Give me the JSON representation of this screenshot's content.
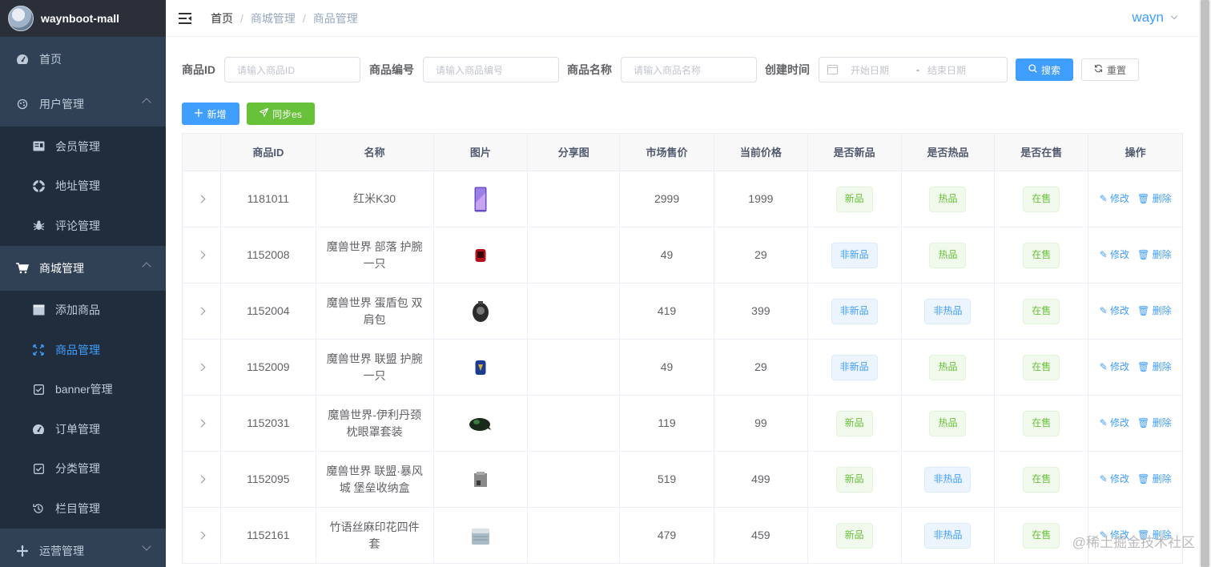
{
  "app": {
    "title": "waynboot-mall"
  },
  "sidebar": {
    "items": [
      {
        "label": "首页",
        "icon": "dashboard-icon"
      },
      {
        "label": "用户管理",
        "icon": "user-icon",
        "expanded": true,
        "children": [
          {
            "label": "会员管理",
            "icon": "member-icon"
          },
          {
            "label": "地址管理",
            "icon": "address-icon"
          },
          {
            "label": "评论管理",
            "icon": "bug-icon"
          }
        ]
      },
      {
        "label": "商城管理",
        "icon": "cart-icon",
        "expanded": true,
        "children": [
          {
            "label": "添加商品",
            "icon": "folder-icon"
          },
          {
            "label": "商品管理",
            "icon": "goods-icon",
            "active": true
          },
          {
            "label": "banner管理",
            "icon": "checkbox-icon"
          },
          {
            "label": "订单管理",
            "icon": "order-icon"
          },
          {
            "label": "分类管理",
            "icon": "checkbox-icon"
          },
          {
            "label": "栏目管理",
            "icon": "column-icon"
          }
        ]
      },
      {
        "label": "运营管理",
        "icon": "plus-icon",
        "expanded": false
      }
    ]
  },
  "header": {
    "breadcrumb": [
      "首页",
      "商城管理",
      "商品管理"
    ],
    "user": "wayn"
  },
  "search": {
    "fields": [
      {
        "label": "商品ID",
        "placeholder": "请输入商品ID"
      },
      {
        "label": "商品编号",
        "placeholder": "请输入商品编号"
      },
      {
        "label": "商品名称",
        "placeholder": "请输入商品名称"
      }
    ],
    "date_label": "创建时间",
    "start_placeholder": "开始日期",
    "range_sep": "-",
    "end_placeholder": "结束日期",
    "search_btn": "搜索",
    "reset_btn": "重置"
  },
  "toolbar": {
    "add_btn": "新增",
    "sync_btn": "同步es"
  },
  "table": {
    "headers": [
      "",
      "商品ID",
      "名称",
      "图片",
      "分享图",
      "市场售价",
      "当前价格",
      "是否新品",
      "是否热品",
      "是否在售",
      "操作"
    ],
    "edit_label": "修改",
    "delete_label": "删除",
    "rows": [
      {
        "id": "1181011",
        "name": "红米K30",
        "market": "2999",
        "price": "1999",
        "new": "新品",
        "hot": "热品",
        "sale": "在售",
        "img": "phone"
      },
      {
        "id": "1152008",
        "name": "魔兽世界 部落 护腕 一只",
        "market": "49",
        "price": "29",
        "new": "非新品",
        "hot": "热品",
        "sale": "在售",
        "img": "red"
      },
      {
        "id": "1152004",
        "name": "魔兽世界 蛋盾包 双肩包",
        "market": "419",
        "price": "399",
        "new": "非新品",
        "hot": "非热品",
        "sale": "在售",
        "img": "bag"
      },
      {
        "id": "1152009",
        "name": "魔兽世界 联盟 护腕 一只",
        "market": "49",
        "price": "29",
        "new": "非新品",
        "hot": "热品",
        "sale": "在售",
        "img": "blue"
      },
      {
        "id": "1152031",
        "name": "魔兽世界-伊利丹颈枕眼罩套装",
        "market": "119",
        "price": "99",
        "new": "新品",
        "hot": "热品",
        "sale": "在售",
        "img": "pillow"
      },
      {
        "id": "1152095",
        "name": "魔兽世界 联盟·暴风城 堡垒收纳盒",
        "market": "519",
        "price": "499",
        "new": "新品",
        "hot": "非热品",
        "sale": "在售",
        "img": "box"
      },
      {
        "id": "1152161",
        "name": "竹语丝麻印花四件套",
        "market": "479",
        "price": "459",
        "new": "新品",
        "hot": "非热品",
        "sale": "在售",
        "img": "bedding"
      }
    ]
  },
  "watermark": "@稀土掘金技术社区",
  "colors": {
    "primary": "#409eff",
    "success": "#67c23a",
    "sidebar": "#304156"
  }
}
